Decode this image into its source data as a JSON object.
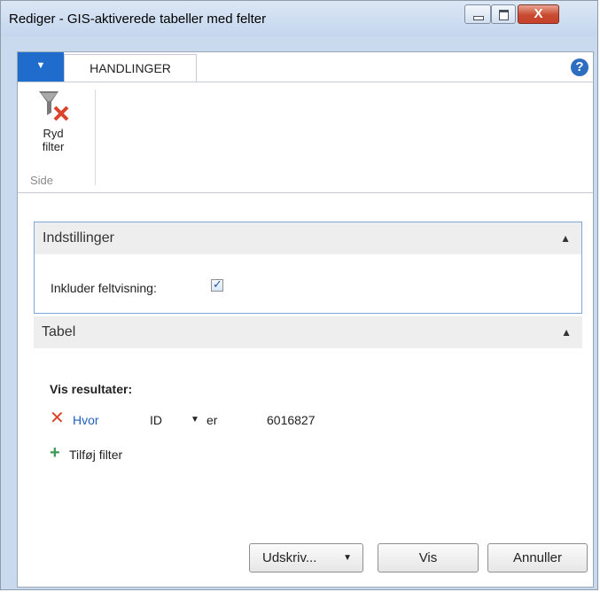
{
  "window": {
    "title": "Rediger - GIS-aktiverede tabeller med felter",
    "close_glyph": "X"
  },
  "ribbon": {
    "file_tab_icon": "caret-down-icon",
    "tab_label": "HANDLINGER",
    "help_glyph": "?",
    "buttons": [
      {
        "label_line1": "Ryd",
        "label_line2": "filter",
        "icon": "clear-filter-icon"
      }
    ],
    "group_label": "Side"
  },
  "fasttabs": {
    "settings": {
      "title": "Indstillinger",
      "field_label": "Inkluder feltvisning:",
      "checked": true
    },
    "table": {
      "title": "Tabel"
    }
  },
  "filters": {
    "heading": "Vis resultater:",
    "rows": [
      {
        "prefix": "Hvor",
        "field": "ID",
        "operator": "er",
        "value": "6016827"
      }
    ],
    "add_label": "Tilføj filter"
  },
  "buttons": {
    "print": "Udskriv...",
    "show": "Vis",
    "cancel": "Annuller"
  },
  "colors": {
    "accent": "#1f6ccc",
    "remove": "#d9452b",
    "add": "#3a9a55",
    "link": "#1f5fbf"
  }
}
